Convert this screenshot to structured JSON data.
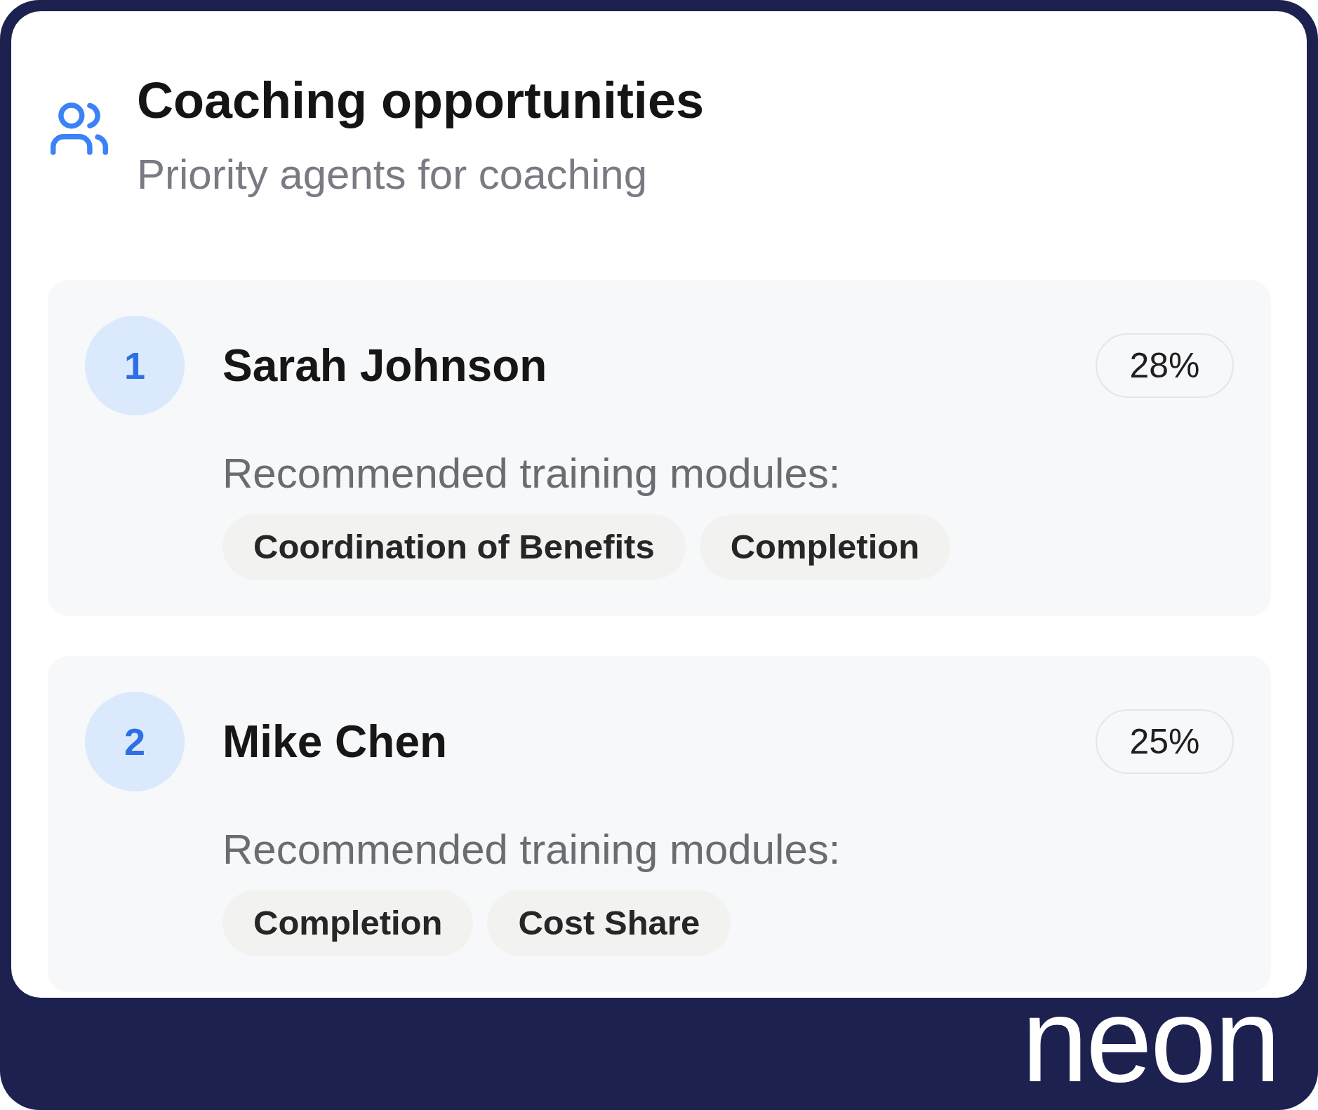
{
  "header": {
    "title": "Coaching opportunities",
    "subtitle": "Priority agents for coaching"
  },
  "agents": [
    {
      "rank": "1",
      "name": "Sarah Johnson",
      "score": "28%",
      "modules_label": "Recommended training modules:",
      "modules": [
        "Coordination of Benefits",
        "Completion"
      ]
    },
    {
      "rank": "2",
      "name": "Mike Chen",
      "score": "25%",
      "modules_label": "Recommended training modules:",
      "modules": [
        "Completion",
        "Cost Share"
      ]
    }
  ],
  "footer": {
    "logo": "neon"
  }
}
